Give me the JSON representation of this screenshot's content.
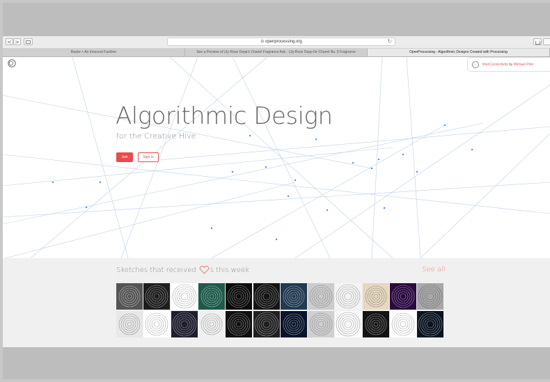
{
  "browser": {
    "nav_back": "<",
    "nav_forward": ">",
    "sidebar_icon": "sidebar-icon",
    "url": "⊙ openprocessing.org",
    "reload_icon": "↻",
    "share_icon": "share-icon",
    "tabs": [
      {
        "label": "Baske + An Innocent Fashion",
        "active": false
      },
      {
        "label": "See a Preview of Lily-Rose Depp's Chanel Fragrance Ads - Lily-Rose Depp for Chanel No. 5 Fragrance",
        "active": false
      },
      {
        "label": "OpenProcessing - Algorithmic Designs Created with Processing",
        "active": true
      }
    ]
  },
  "site": {
    "logo_icon": "openprocessing-logo-icon",
    "credit": {
      "sketch": "InterConnectivity",
      "by": "by",
      "author": "Michael Pinn"
    },
    "hero": {
      "title": "Algorithmic Design",
      "subtitle": "for the Creative Hive",
      "join_label": "Join",
      "signin_label": "Sign in"
    },
    "sketches": {
      "heading_before": "Sketches that received",
      "heading_after": "s this week",
      "see_all": "See all"
    },
    "thumb_colors_row1": [
      "#555555",
      "#1e1e1e",
      "#ffffff",
      "#1e5a4a",
      "#0c0c0c",
      "#141414",
      "#223a52",
      "#cccccc",
      "#f4f4f4",
      "#e6d8c0",
      "#2a0a40",
      "#a8a8a8"
    ],
    "thumb_colors_row2": [
      "#e8e8e8",
      "#ffffff",
      "#1e1e2e",
      "#f0f0f0",
      "#111111",
      "#202020",
      "#08142a",
      "#d0d0d0",
      "#fafafa",
      "#141414",
      "#ffffff",
      "#0a1420"
    ],
    "accent": "#e84c4c",
    "network_color": "#4a90e2"
  }
}
